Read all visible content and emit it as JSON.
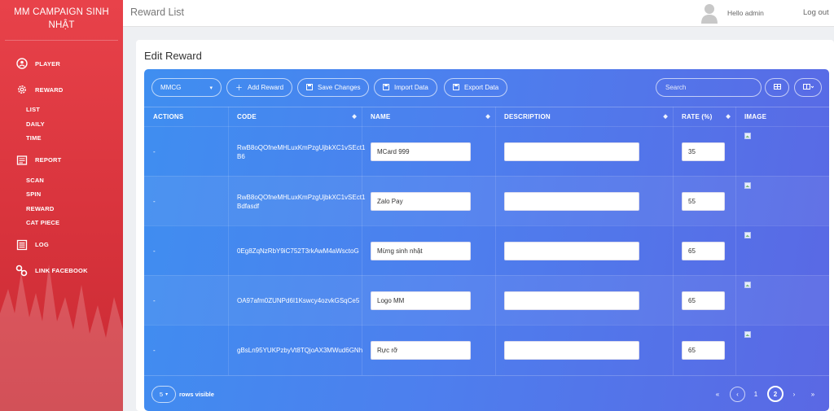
{
  "brand": {
    "line1": "MM CAMPAIGN SINH",
    "line2": "NHẬT"
  },
  "nav": {
    "player": "PLAYER",
    "reward": "REWARD",
    "reward_sub": [
      "LIST",
      "DAILY",
      "TIME"
    ],
    "report": "REPORT",
    "report_sub": [
      "SCAN",
      "SPIN",
      "REWARD",
      "CAT PIECE"
    ],
    "log": "LOG",
    "link_facebook": "LINK FACEBOOK"
  },
  "topbar": {
    "title": "Reward List",
    "hello": "Hello admin",
    "logout": "Log out"
  },
  "page": {
    "title": "Edit Reward"
  },
  "toolbar": {
    "campaign": "MMCG",
    "add": "Add Reward",
    "save": "Save Changes",
    "import": "Import Data",
    "export": "Export Data",
    "search_placeholder": "Search"
  },
  "table": {
    "headers": {
      "actions": "ACTIONS",
      "code": "CODE",
      "name": "NAME",
      "description": "DESCRIPTION",
      "rate": "RATE (%)",
      "image": "IMAGE"
    },
    "rows": [
      {
        "action": "-",
        "code": "RwB8oQOfneMHLuxKmPzgUjbkXC1vSEct1B6",
        "name": "MCard 999",
        "description": "",
        "rate": "35"
      },
      {
        "action": "-",
        "code": "RwB8oQOfneMHLuxKmPzgUjbkXC1vSEct1Bdfasdf",
        "name": "Zalo Pay",
        "description": "",
        "rate": "55"
      },
      {
        "action": "-",
        "code": "0Eg8ZqNzRbY9iC752T3rkAwM4aWsctoG",
        "name": "Mừng sinh nhật",
        "description": "",
        "rate": "65"
      },
      {
        "action": "-",
        "code": "OA97afm0ZUNPd6I1Kswcy4ozvkGSqCe5",
        "name": "Logo MM",
        "description": "",
        "rate": "65"
      },
      {
        "action": "-",
        "code": "gBsLn95YUKPzbyVt8TQjoAX3MWud6GNh",
        "name": "Rực rỡ",
        "description": "",
        "rate": "65"
      }
    ]
  },
  "footer": {
    "page_size": "5",
    "rows_visible": "rows visible",
    "pages": [
      "1",
      "2"
    ],
    "current_page": "2",
    "first": "«",
    "prev": "‹",
    "next": "›",
    "last": "»"
  },
  "colors": {
    "sidebar": "#e8424a",
    "panel_start": "#3f8ef0",
    "panel_end": "#5a68e4"
  }
}
